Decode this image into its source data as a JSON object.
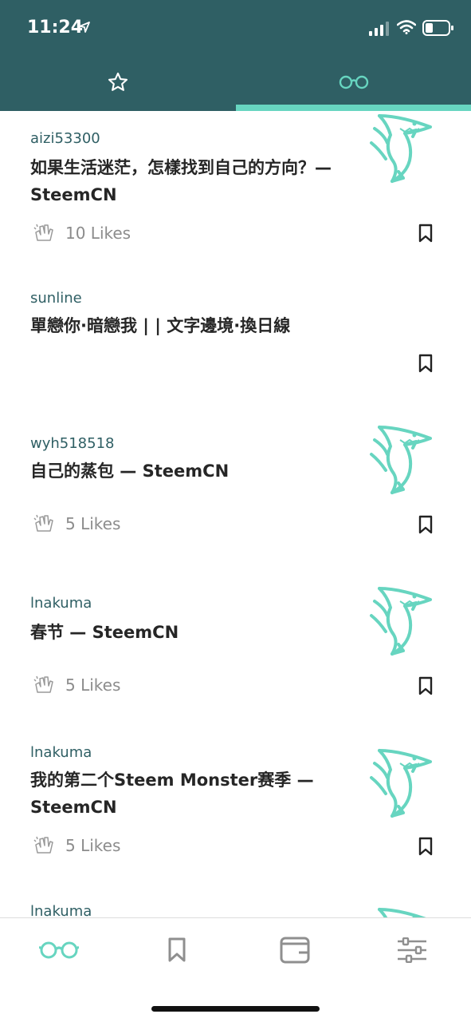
{
  "status_bar": {
    "time": "11:24"
  },
  "colors": {
    "header": "#2f5f64",
    "accent": "#67d5c0",
    "author": "#2f5f64",
    "text": "#262626",
    "muted": "#8c8c8c"
  },
  "top_tabs": [
    {
      "icon": "star-icon",
      "active": false
    },
    {
      "icon": "glasses-icon",
      "active": true
    }
  ],
  "posts": [
    {
      "author": "aizi53300",
      "title": "如果生活迷茫，怎樣找到自己的方向？— SteemCN",
      "likes": "10 Likes",
      "has_thumbnail": true
    },
    {
      "author": "sunline",
      "title": "單戀你·暗戀我 | | 文字邊境·換日線",
      "likes": "",
      "has_thumbnail": false
    },
    {
      "author": "wyh518518",
      "title": "自己的蒸包 — SteemCN",
      "likes": "5 Likes",
      "has_thumbnail": true
    },
    {
      "author": "lnakuma",
      "title": "春节 — SteemCN",
      "likes": "5 Likes",
      "has_thumbnail": true
    },
    {
      "author": "lnakuma",
      "title": "我的第二个Steem Monster赛季 — SteemCN",
      "likes": "5 Likes",
      "has_thumbnail": true
    },
    {
      "author": "lnakuma",
      "title": "",
      "likes": "",
      "has_thumbnail": true
    }
  ],
  "bottom_nav": [
    {
      "icon": "glasses-icon",
      "active": true
    },
    {
      "icon": "bookmark-icon",
      "active": false
    },
    {
      "icon": "wallet-icon",
      "active": false
    },
    {
      "icon": "settings-sliders-icon",
      "active": false
    }
  ]
}
